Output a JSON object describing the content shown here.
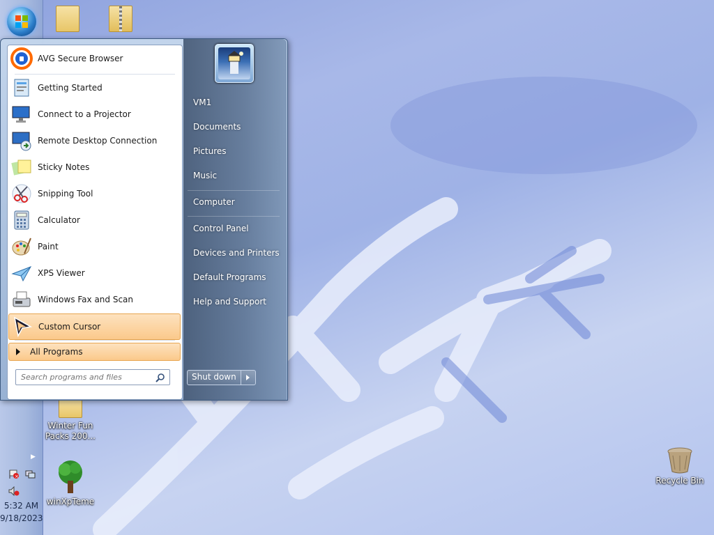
{
  "desktop": {
    "icons_top": [
      "",
      ""
    ],
    "icons": [
      {
        "label": "Winter Fun Packs 200..."
      },
      {
        "label": "winXpTeme"
      },
      {
        "label": "Recycle Bin"
      }
    ]
  },
  "taskbar": {
    "clock_time": "5:32 AM",
    "clock_date": "9/18/2023"
  },
  "start_menu": {
    "programs": [
      {
        "label": "AVG Secure Browser",
        "icon": "avg-browser-icon"
      },
      {
        "label": "Getting Started",
        "icon": "getting-started-icon"
      },
      {
        "label": "Connect to a Projector",
        "icon": "projector-icon"
      },
      {
        "label": "Remote Desktop Connection",
        "icon": "remote-desktop-icon"
      },
      {
        "label": "Sticky Notes",
        "icon": "sticky-notes-icon"
      },
      {
        "label": "Snipping Tool",
        "icon": "scissors-icon"
      },
      {
        "label": "Calculator",
        "icon": "calculator-icon"
      },
      {
        "label": "Paint",
        "icon": "paint-palette-icon"
      },
      {
        "label": "XPS Viewer",
        "icon": "xps-viewer-icon"
      },
      {
        "label": "Windows Fax and Scan",
        "icon": "fax-icon"
      },
      {
        "label": "Custom Cursor",
        "icon": "cursor-icon"
      }
    ],
    "all_programs": "All Programs",
    "search_placeholder": "Search programs and files",
    "right_items": [
      "VM1",
      "Documents",
      "Pictures",
      "Music",
      "Computer",
      "Control Panel",
      "Devices and Printers",
      "Default Programs",
      "Help and Support"
    ],
    "shutdown_label": "Shut down"
  }
}
